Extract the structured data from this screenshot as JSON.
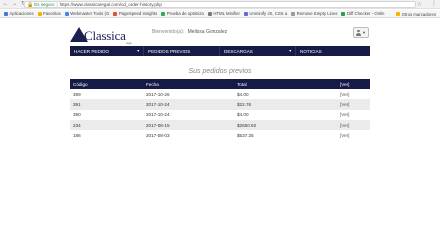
{
  "browser": {
    "secure_label": "Es seguro",
    "url": "https://www.classicaregal.com/cd_order-history.php",
    "bookmarks": [
      {
        "label": "Aplicaciones",
        "color": "#4a78d6"
      },
      {
        "label": "Favoritos",
        "color": "#f4b400"
      },
      {
        "label": "Webmaster Tools (G",
        "color": "#4285f4"
      },
      {
        "label": "PageSpeed Insights",
        "color": "#e84b3c"
      },
      {
        "label": "Prueba de optimiza",
        "color": "#34a853"
      },
      {
        "label": "HTML Minifier",
        "color": "#7a7a7a"
      },
      {
        "label": "Unminify JS, CSS a",
        "color": "#5f6bd3"
      },
      {
        "label": "Remove Empty Lines",
        "color": "#999999"
      },
      {
        "label": "Diff Checker - Onlin",
        "color": "#2e9e4a"
      }
    ],
    "bookmarks_overflow": "Otros marcadores"
  },
  "header": {
    "logo_text": "Classica",
    "logo_sub": "regal",
    "welcome_label": "Bienvenido(a):",
    "user_name": "Melissa Gonzalez"
  },
  "nav": {
    "items": [
      {
        "label": "Hacer Pedido",
        "dropdown": true
      },
      {
        "label": "Pedidos previos",
        "dropdown": false
      },
      {
        "label": "Descargas",
        "dropdown": true
      },
      {
        "label": "Noticias",
        "dropdown": false
      }
    ]
  },
  "orders": {
    "title": "Sus pedidos previos",
    "columns": [
      "Código",
      "Fecha",
      "Total",
      "[Ver]"
    ],
    "rows": [
      {
        "code": "399",
        "date": "2017-10-26",
        "total": "$4.00",
        "view": "[Ver]"
      },
      {
        "code": "391",
        "date": "2017-10-24",
        "total": "$22.76",
        "view": "[Ver]"
      },
      {
        "code": "390",
        "date": "2017-10-24",
        "total": "$4.00",
        "view": "[Ver]"
      },
      {
        "code": "234",
        "date": "2017-08-15",
        "total": "$2650.92",
        "view": "[Ver]"
      },
      {
        "code": "186",
        "date": "2017-08-03",
        "total": "$537.25",
        "view": "[Ver]"
      }
    ]
  },
  "colors": {
    "brand_navy": "#151a46",
    "row_stripe": "#ebebeb"
  }
}
